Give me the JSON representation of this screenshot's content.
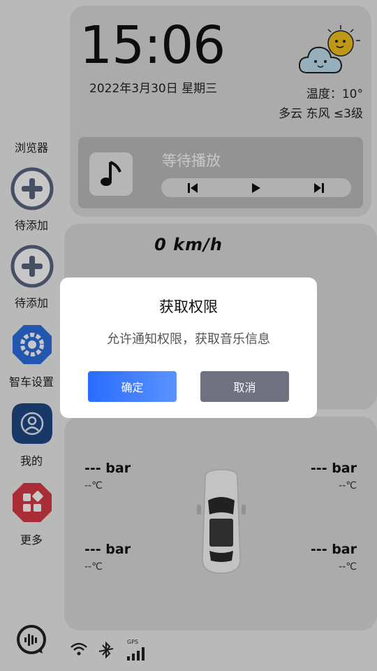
{
  "sidebar": {
    "browser_label": "浏览器",
    "items": [
      {
        "label": "待添加",
        "icon": "plus-circle-icon"
      },
      {
        "label": "待添加",
        "icon": "plus-circle-icon"
      },
      {
        "label": "智车设置",
        "icon": "gear-icon"
      },
      {
        "label": "我的",
        "icon": "user-icon"
      },
      {
        "label": "更多",
        "icon": "grid-icon"
      }
    ]
  },
  "clock": {
    "time": "15:06",
    "date": "2022年3月30日   星期三"
  },
  "weather": {
    "temperature": "温度：10°",
    "condition_wind": "多云  东风  ≤3级",
    "icon": "sun-cloud-icon"
  },
  "music": {
    "title": "等待播放",
    "thumb_icon": "music-note-icon"
  },
  "speed": {
    "value": "0 km/h"
  },
  "tires": [
    {
      "pressure": "--- bar",
      "temp": "--℃"
    },
    {
      "pressure": "--- bar",
      "temp": "--℃"
    },
    {
      "pressure": "--- bar",
      "temp": "--℃"
    },
    {
      "pressure": "--- bar",
      "temp": "--℃"
    }
  ],
  "dialog": {
    "title": "获取权限",
    "message": "允许通知权限，获取音乐信息",
    "confirm_label": "确定",
    "cancel_label": "取消"
  },
  "status": {
    "gps_label": "GPS"
  },
  "colors": {
    "accent": "#2a6bff",
    "cancel": "#6f7180",
    "card": "#dcdcdc"
  }
}
